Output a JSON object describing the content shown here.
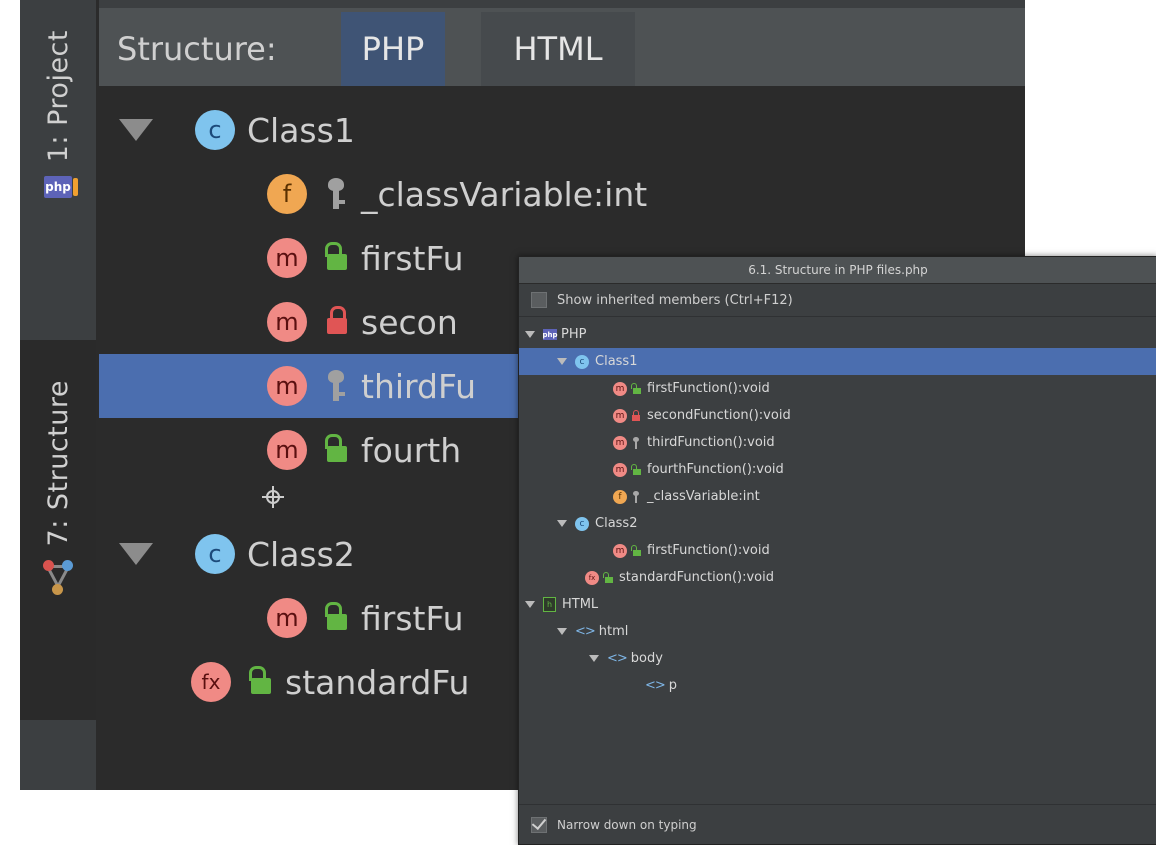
{
  "toolstrip": {
    "project_tab": "1: Project",
    "structure_tab": "7: Structure",
    "php_badge": "php"
  },
  "panel": {
    "title": "Structure:",
    "tabs": [
      {
        "label": "PHP",
        "active": true
      },
      {
        "label": "HTML",
        "active": false
      }
    ],
    "rows": [
      {
        "badge": "c",
        "text": "Class1"
      },
      {
        "badge": "f",
        "access": "key",
        "text": "_classVariable:int"
      },
      {
        "badge": "m",
        "access": "public",
        "text": "firstFunction():void"
      },
      {
        "badge": "m",
        "access": "private",
        "text": "secondFunction():void"
      },
      {
        "badge": "m",
        "access": "key",
        "text": "thirdFunction():void"
      },
      {
        "badge": "m",
        "access": "public",
        "text": "fourthFunction():void"
      },
      {
        "badge": "c",
        "text": "Class2"
      },
      {
        "badge": "m",
        "access": "public",
        "text": "firstFunction():void"
      },
      {
        "badge": "fx",
        "access": "public",
        "text": "standardFunction():void"
      }
    ],
    "visible_text": [
      "Class1",
      "_classVariable:int",
      "firstFu",
      "secon",
      "thirdFu",
      "fourth",
      "Class2",
      "firstFu",
      "standardFu"
    ]
  },
  "popup": {
    "title": "6.1. Structure in PHP files.php",
    "show_inherited": {
      "label": "Show inherited members (Ctrl+F12)",
      "checked": false
    },
    "narrow_down": {
      "label": "Narrow down on typing",
      "checked": true
    },
    "tree": [
      {
        "text": "PHP",
        "badge_text": "php"
      },
      {
        "text": "Class1",
        "badge_text": "c",
        "selected": true
      },
      {
        "text": "firstFunction():void",
        "badge_text": "m"
      },
      {
        "text": "secondFunction():void",
        "badge_text": "m"
      },
      {
        "text": "thirdFunction():void",
        "badge_text": "m"
      },
      {
        "text": "fourthFunction():void",
        "badge_text": "m"
      },
      {
        "text": "_classVariable:int",
        "badge_text": "f"
      },
      {
        "text": "Class2",
        "badge_text": "c"
      },
      {
        "text": "firstFunction():void",
        "badge_text": "m"
      },
      {
        "text": "standardFunction():void",
        "badge_text": "fx"
      },
      {
        "text": "HTML",
        "badge_text": "h"
      },
      {
        "text": "html",
        "badge_text": "<>"
      },
      {
        "text": "body",
        "badge_text": "<>"
      },
      {
        "text": "p",
        "badge_text": "<>"
      }
    ]
  },
  "colors": {
    "selection": "#4b6eaf",
    "panel_bg": "#2b2b2b",
    "chrome_bg": "#3c3f41",
    "method_badge": "#f08a85",
    "class_badge": "#7fc4ee",
    "field_badge": "#f0a752",
    "public_access": "#62b543",
    "private_access": "#e05555"
  }
}
